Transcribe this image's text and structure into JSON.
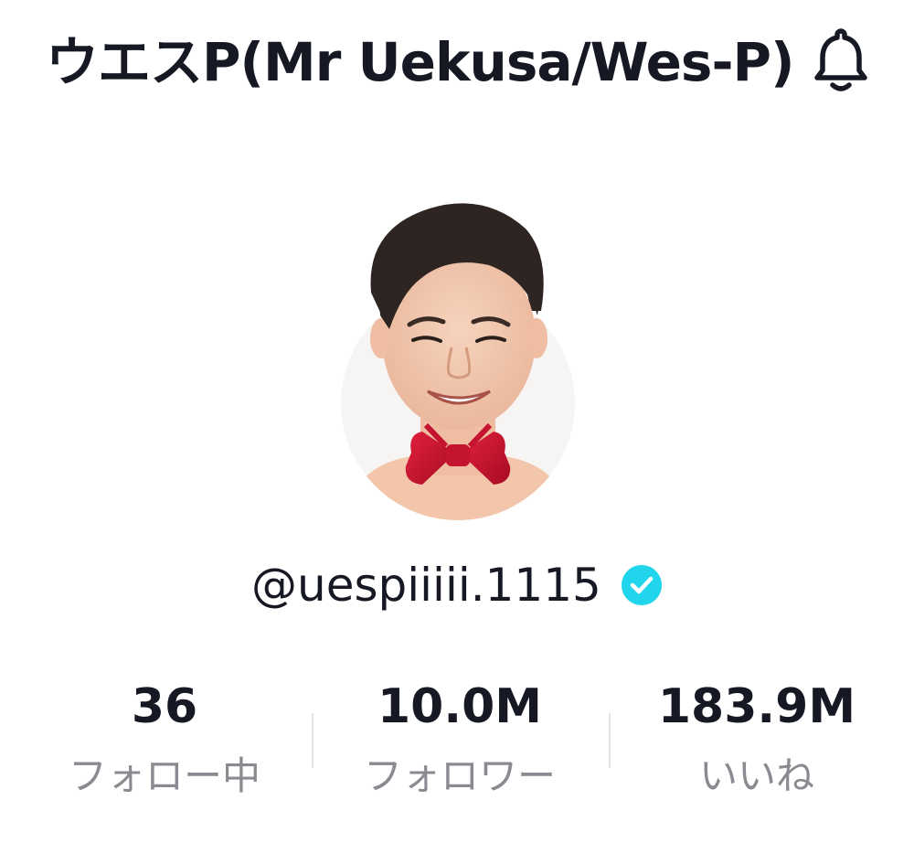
{
  "header": {
    "title": "ウエスP(Mr Uekusa/Wes-P)",
    "notification_icon": "bell-icon"
  },
  "profile": {
    "avatar_icon": "profile-photo",
    "handle": "@uespiiiii.1115",
    "verified_icon": "verified-badge-icon",
    "verified_color": "#20D5EC"
  },
  "stats": [
    {
      "value": "36",
      "label": "フォロー中"
    },
    {
      "value": "10.0M",
      "label": "フォロワー"
    },
    {
      "value": "183.9M",
      "label": "いいね"
    }
  ],
  "colors": {
    "text": "#161823",
    "label": "#8A8B91",
    "bow_tie": "#D0102A"
  }
}
